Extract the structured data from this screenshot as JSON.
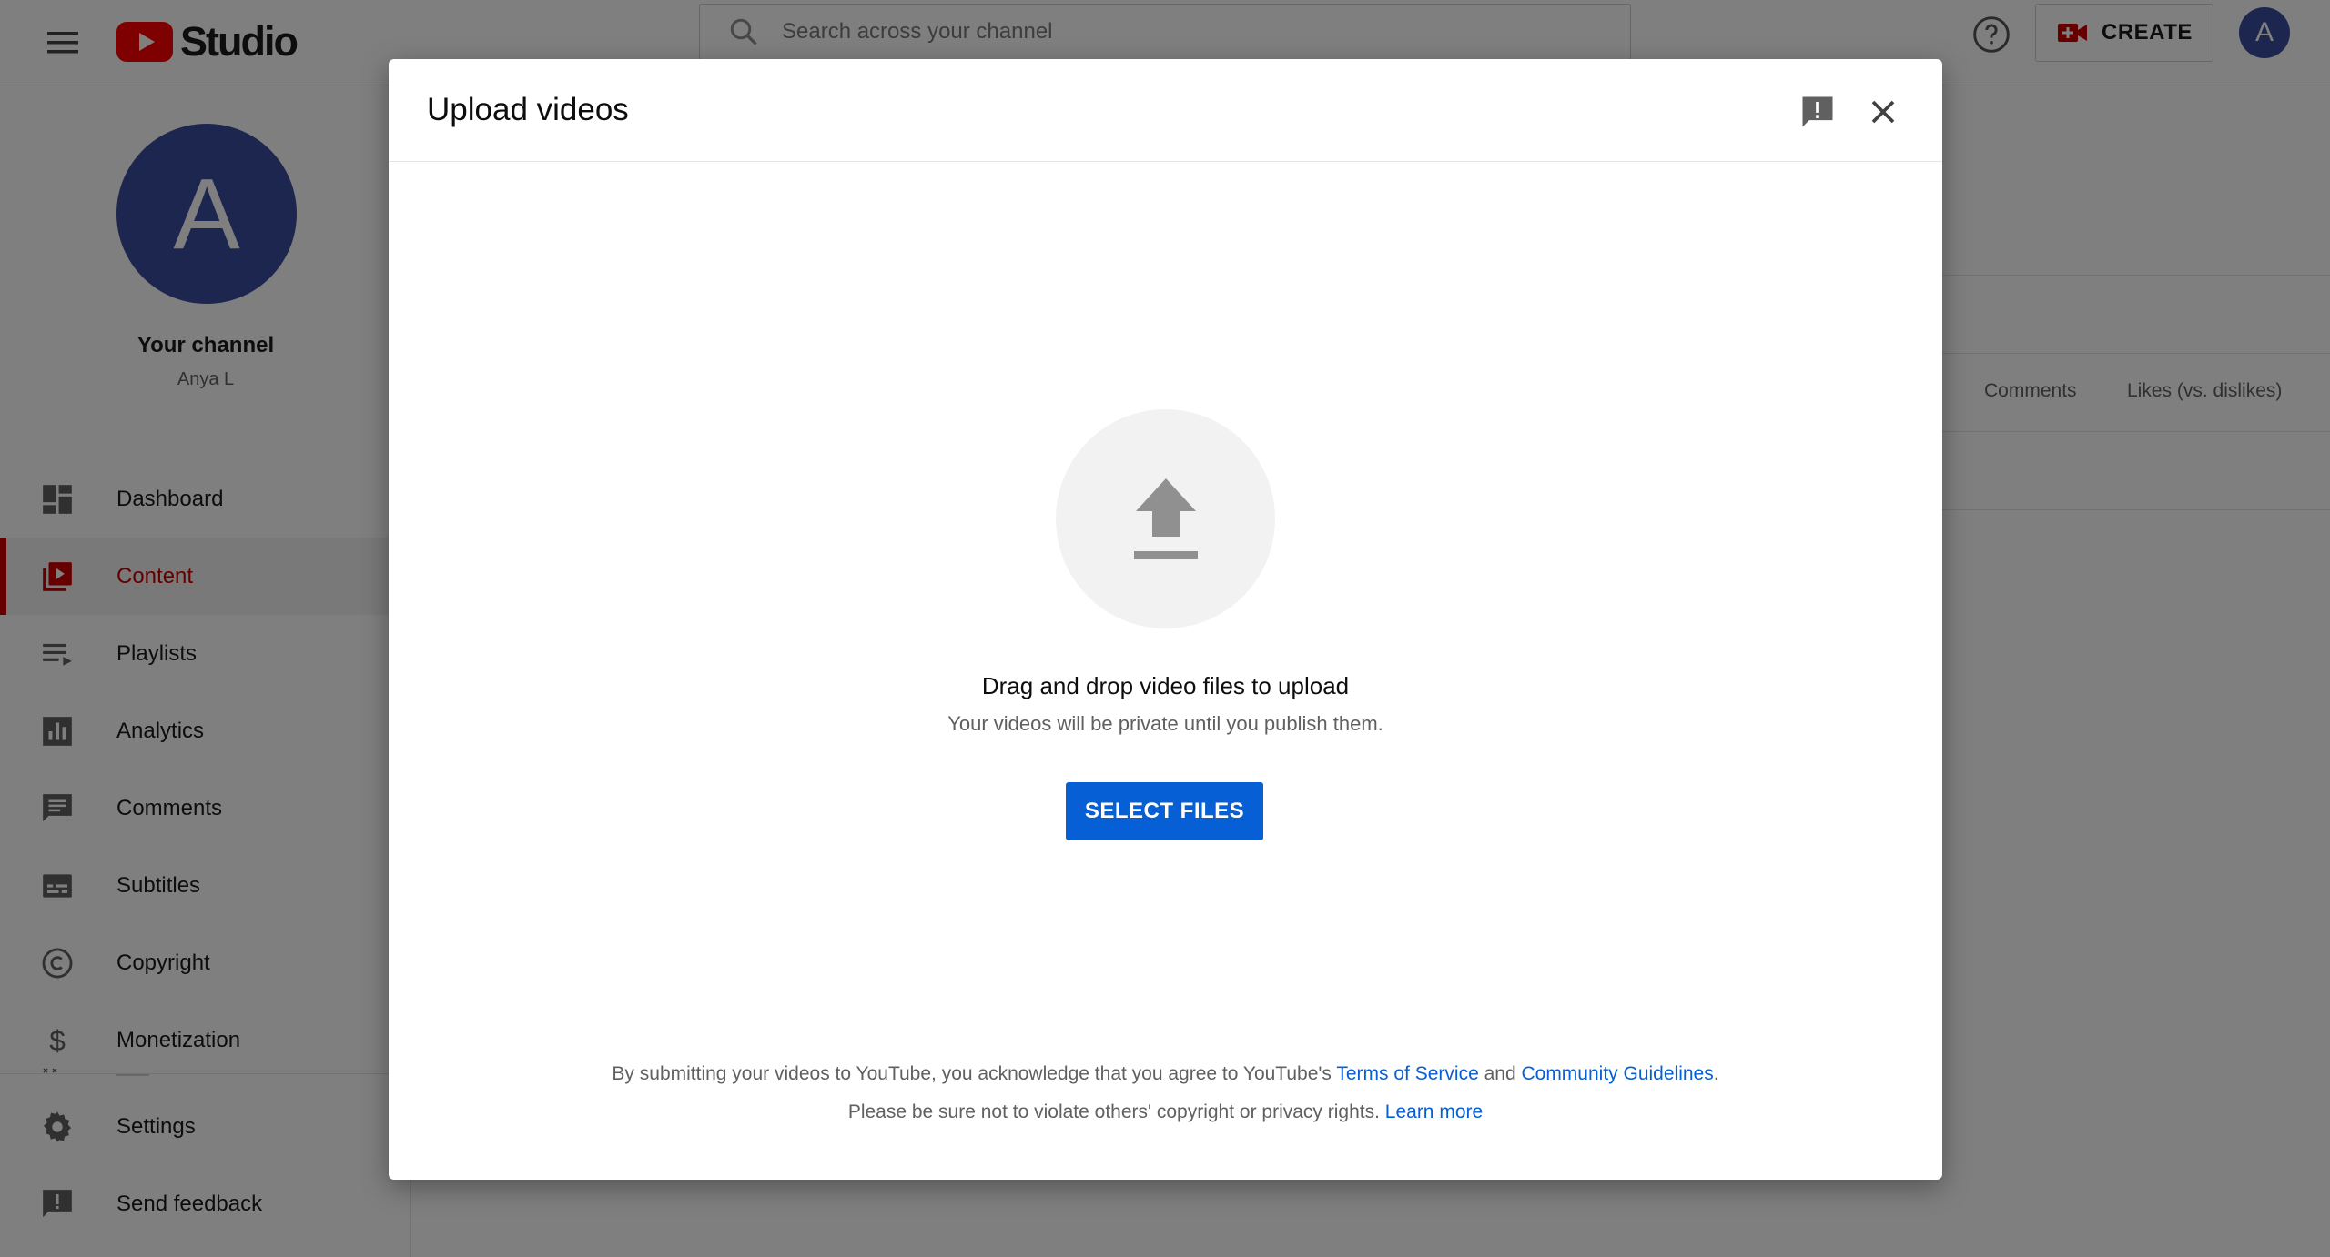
{
  "header": {
    "logo_text": "Studio",
    "search_placeholder": "Search across your channel",
    "create_label": "CREATE",
    "avatar_letter": "A"
  },
  "sidebar": {
    "avatar_letter": "A",
    "channel_title": "Your channel",
    "channel_name": "Anya L",
    "items": [
      {
        "label": "Dashboard",
        "icon": "dashboard-icon"
      },
      {
        "label": "Content",
        "icon": "content-icon",
        "active": true
      },
      {
        "label": "Playlists",
        "icon": "playlists-icon"
      },
      {
        "label": "Analytics",
        "icon": "analytics-icon"
      },
      {
        "label": "Comments",
        "icon": "comments-icon"
      },
      {
        "label": "Subtitles",
        "icon": "subtitles-icon"
      },
      {
        "label": "Copyright",
        "icon": "copyright-icon"
      },
      {
        "label": "Monetization",
        "icon": "monetization-icon"
      }
    ],
    "bottom_items": [
      {
        "label": "Settings",
        "icon": "gear-icon"
      },
      {
        "label": "Send feedback",
        "icon": "feedback-icon"
      }
    ]
  },
  "background": {
    "columns": [
      "Comments",
      "Likes (vs. dislikes)"
    ]
  },
  "dialog": {
    "title": "Upload videos",
    "drag_text": "Drag and drop video files to upload",
    "private_text": "Your videos will be private until you publish them.",
    "select_button": "SELECT FILES",
    "legal_line1_prefix": "By submitting your videos to YouTube, you acknowledge that you agree to YouTube's ",
    "terms_link": "Terms of Service",
    "legal_and": " and ",
    "guidelines_link": "Community Guidelines",
    "legal_period": ".",
    "legal_line2_prefix": "Please be sure not to violate others' copyright or privacy rights. ",
    "learn_more_link": "Learn more"
  },
  "colors": {
    "accent_red": "#cc0000",
    "brand_red": "#ff0000",
    "link_blue": "#065fd4",
    "avatar_blue": "#3b4d9c"
  }
}
